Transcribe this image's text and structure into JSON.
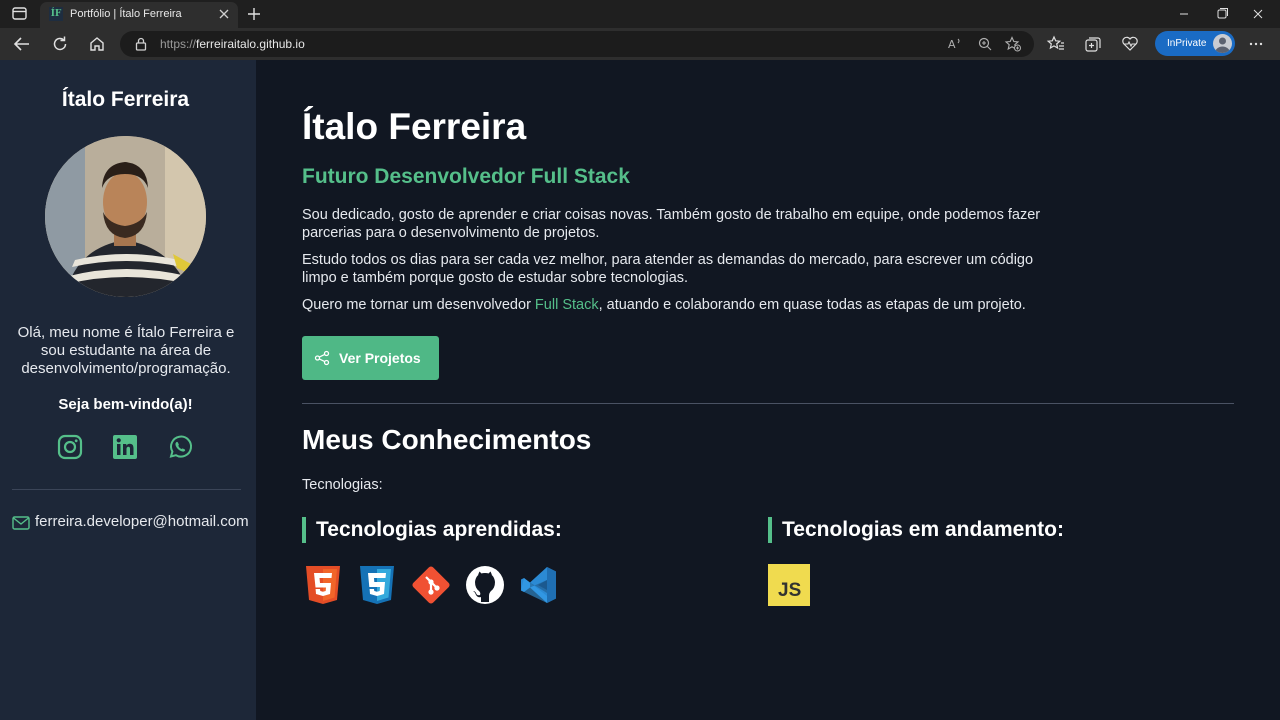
{
  "browser": {
    "tab_title": "Portfólio | Ítalo Ferreira",
    "favicon_text": "ÍF",
    "url_scheme": "https://",
    "url_host": "ferreiraitalo.github.io",
    "inprivate_label": "InPrivate"
  },
  "sidebar": {
    "name": "Ítalo Ferreira",
    "bio": "Olá, meu nome é Ítalo Ferreira e sou estudante na área de desenvolvimento/programação.",
    "welcome": "Seja bem-vindo(a)!",
    "social": [
      "instagram-icon",
      "linkedin-icon",
      "whatsapp-icon"
    ],
    "email": "ferreira.developer@hotmail.com"
  },
  "main": {
    "title": "Ítalo Ferreira",
    "subtitle": "Futuro Desenvolvedor Full Stack",
    "p1": "Sou dedicado, gosto de aprender e criar coisas novas. Também gosto de trabalho em equipe, onde podemos fazer parcerias para o desenvolvimento de projetos.",
    "p2": "Estudo todos os dias para ser cada vez melhor, para atender as demandas do mercado, para escrever um código limpo e também porque gosto de estudar sobre tecnologias.",
    "p3_before": "Quero me tornar um desenvolvedor ",
    "p3_highlight": "Full Stack",
    "p3_after": ", atuando e colaborando em quase todas as etapas de um projeto.",
    "button_label": "Ver Projetos",
    "skills_title": "Meus Conhecimentos",
    "tech_label": "Tecnologias:",
    "learned_title": "Tecnologias aprendidas:",
    "learned_icons": [
      "html5-icon",
      "css3-icon",
      "git-icon",
      "github-icon",
      "vscode-icon"
    ],
    "inprogress_title": "Tecnologias em andamento:",
    "inprogress_icons": [
      "javascript-icon"
    ],
    "js_badge": "JS"
  },
  "colors": {
    "accent": "#55bf8a",
    "sidebar_bg": "#1d2738",
    "main_bg": "#111722",
    "button_bg": "#4fb886"
  }
}
